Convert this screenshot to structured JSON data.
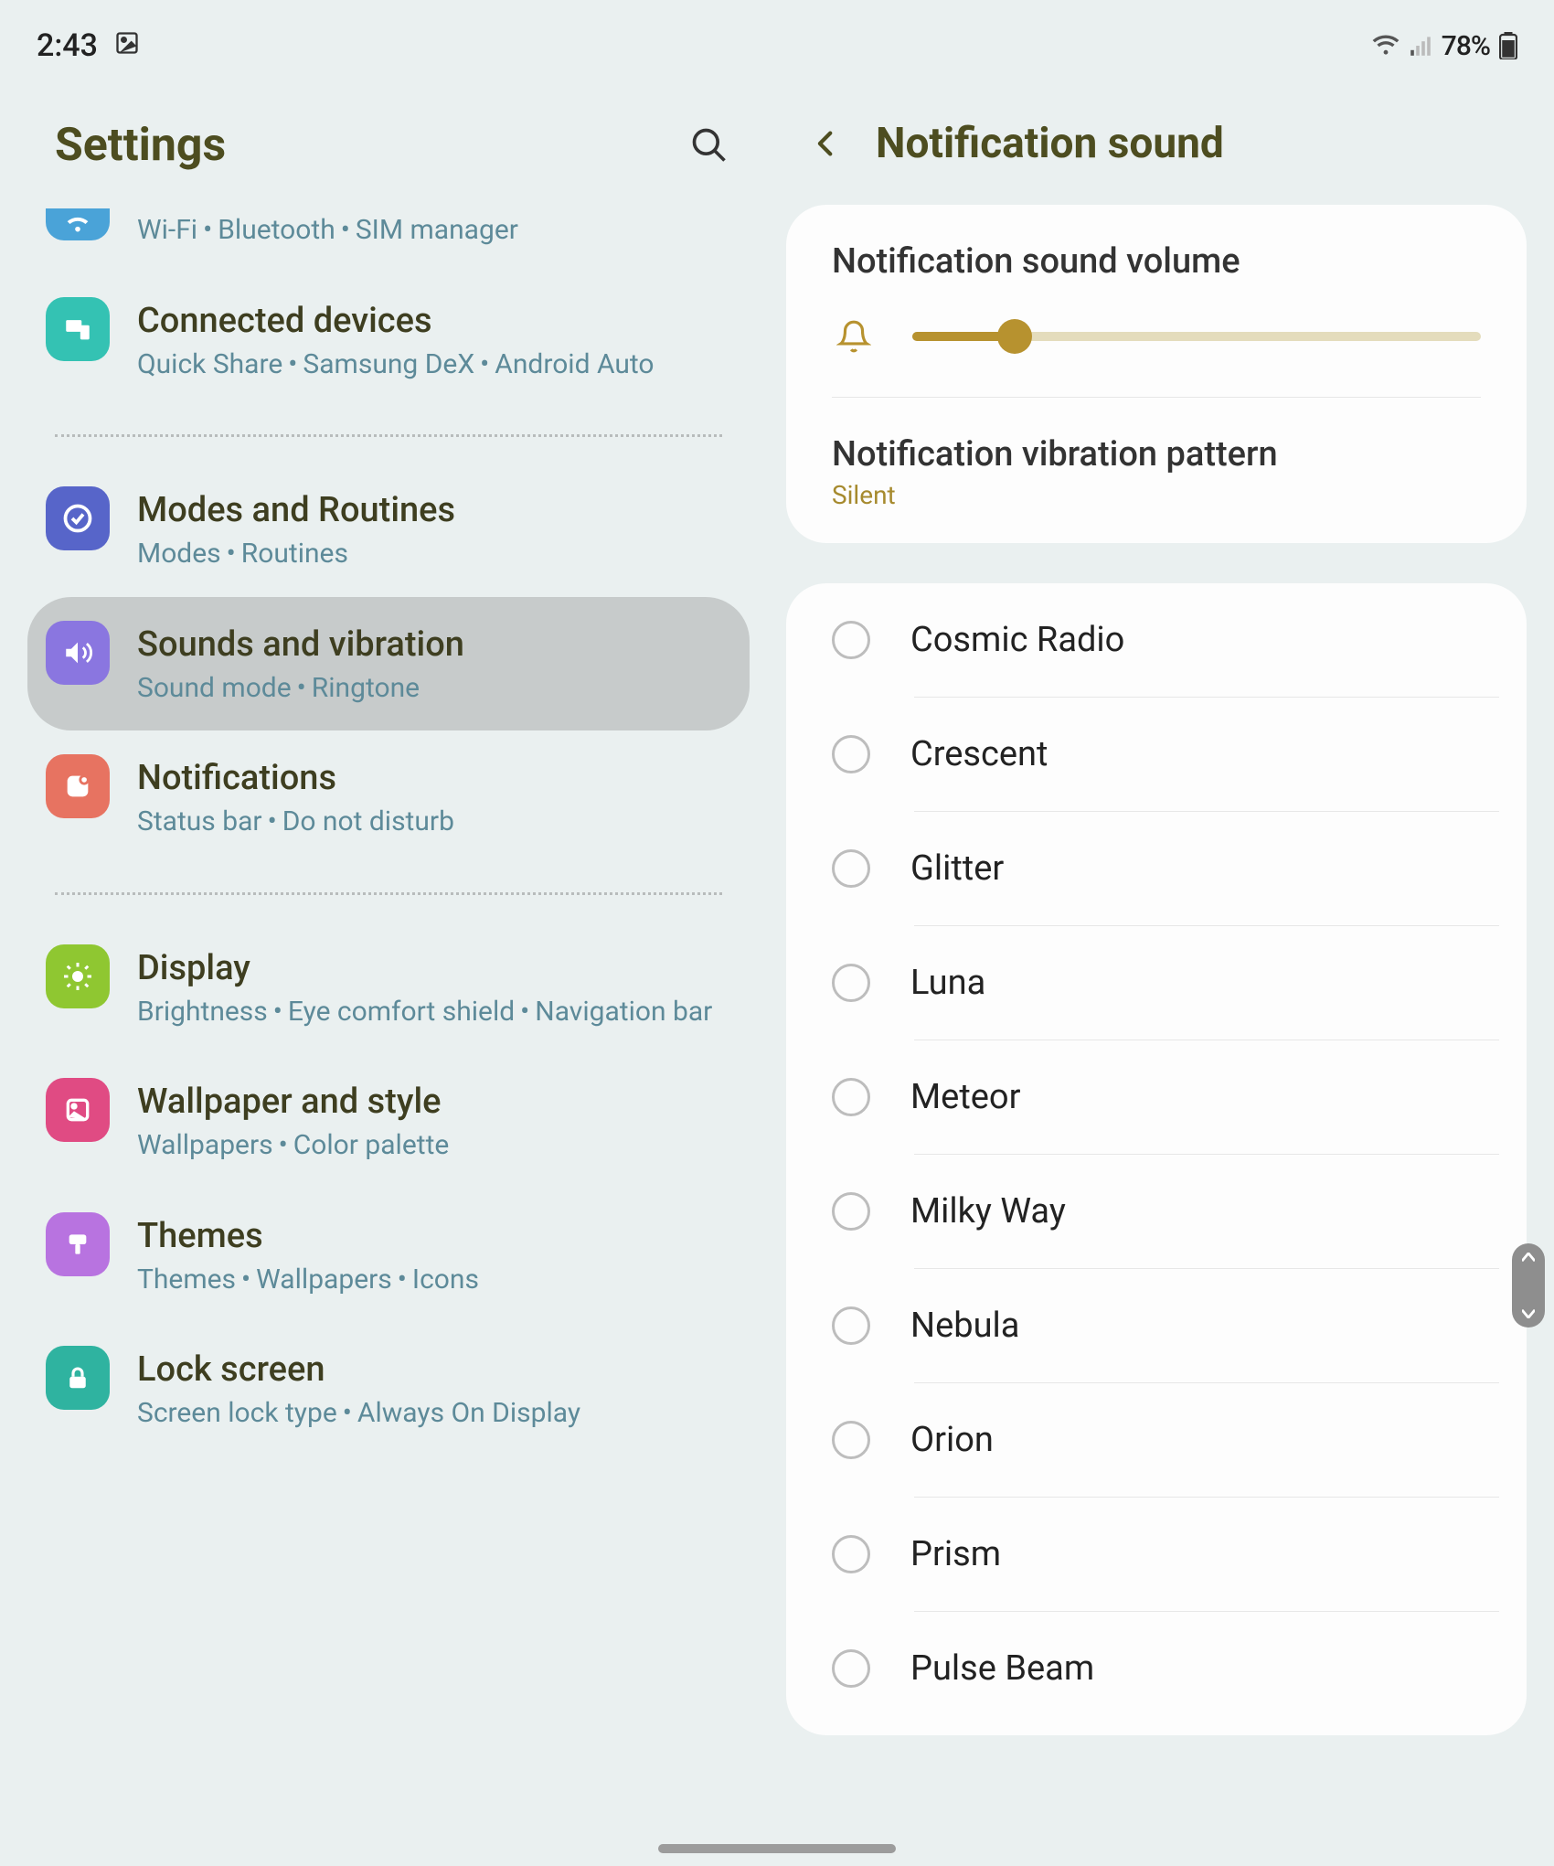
{
  "status": {
    "time": "2:43",
    "battery_pct": "78%"
  },
  "left": {
    "title": "Settings",
    "items": [
      {
        "title": "",
        "sub": [
          "Wi-Fi",
          "Bluetooth",
          "SIM manager"
        ],
        "icon": "wifi",
        "color": "#4aa3d8",
        "truncated": true
      },
      {
        "title": "Connected devices",
        "sub": [
          "Quick Share",
          "Samsung DeX",
          "Android Auto"
        ],
        "icon": "devices",
        "color": "#34c2b3"
      },
      "divider",
      {
        "title": "Modes and Routines",
        "sub": [
          "Modes",
          "Routines"
        ],
        "icon": "check-circle",
        "color": "#5765c9"
      },
      {
        "title": "Sounds and vibration",
        "sub": [
          "Sound mode",
          "Ringtone"
        ],
        "icon": "speaker",
        "color": "#8a76e0",
        "selected": true
      },
      {
        "title": "Notifications",
        "sub": [
          "Status bar",
          "Do not disturb"
        ],
        "icon": "bell-square",
        "color": "#e77361"
      },
      "divider",
      {
        "title": "Display",
        "sub": [
          "Brightness",
          "Eye comfort shield",
          "Navigation bar"
        ],
        "icon": "sun",
        "color": "#8fc731"
      },
      {
        "title": "Wallpaper and style",
        "sub": [
          "Wallpapers",
          "Color palette"
        ],
        "icon": "wallpaper",
        "color": "#e04b83"
      },
      {
        "title": "Themes",
        "sub": [
          "Themes",
          "Wallpapers",
          "Icons"
        ],
        "icon": "brush",
        "color": "#b873e0"
      },
      {
        "title": "Lock screen",
        "sub": [
          "Screen lock type",
          "Always On Display"
        ],
        "icon": "lock",
        "color": "#2fb3a0"
      }
    ]
  },
  "right": {
    "title": "Notification sound",
    "volume_label": "Notification sound volume",
    "volume_pct": 18,
    "vibration_label": "Notification vibration pattern",
    "vibration_value": "Silent",
    "sounds": [
      "Cosmic Radio",
      "Crescent",
      "Glitter",
      "Luna",
      "Meteor",
      "Milky Way",
      "Nebula",
      "Orion",
      "Prism",
      "Pulse Beam"
    ]
  },
  "colors": {
    "accent": "#b7922f",
    "link": "#5d8a99"
  }
}
